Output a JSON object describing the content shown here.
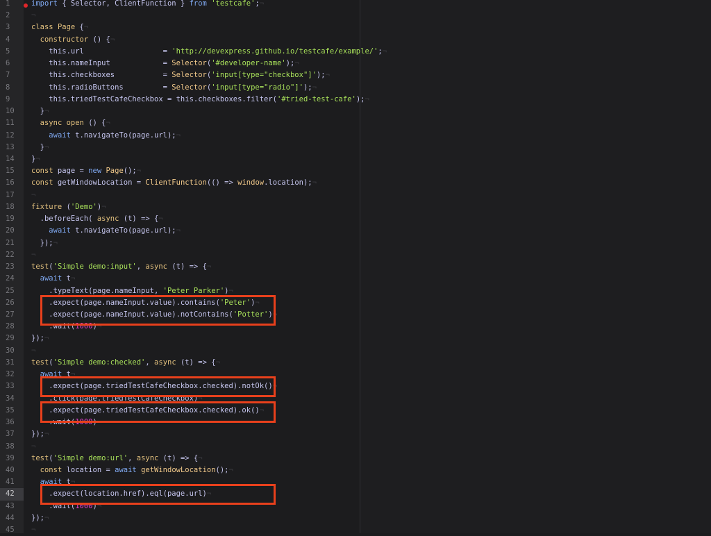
{
  "editor": {
    "current_line": 42,
    "breakpoint_line": 1,
    "highlight_color": "#e8401c",
    "lines": [
      [
        [
          "k",
          "import"
        ],
        [
          "p",
          " { Selector, ClientFunction } "
        ],
        [
          "k",
          "from"
        ],
        [
          "p",
          " "
        ],
        [
          "s",
          "'testcafe'"
        ],
        [
          "p",
          ";"
        ]
      ],
      [],
      [
        [
          "d",
          "class"
        ],
        [
          "p",
          " "
        ],
        [
          "d",
          "Page"
        ],
        [
          "p",
          " {"
        ]
      ],
      [
        [
          "p",
          "  "
        ],
        [
          "d",
          "constructor"
        ],
        [
          "p",
          " () {"
        ]
      ],
      [
        [
          "p",
          "    this.url                  = "
        ],
        [
          "s",
          "'http://devexpress.github.io/testcafe/example/'"
        ],
        [
          "p",
          ";"
        ]
      ],
      [
        [
          "p",
          "    this.nameInput            = "
        ],
        [
          "f",
          "Selector"
        ],
        [
          "p",
          "("
        ],
        [
          "s",
          "'#developer-name'"
        ],
        [
          "p",
          ");"
        ]
      ],
      [
        [
          "p",
          "    this.checkboxes           = "
        ],
        [
          "f",
          "Selector"
        ],
        [
          "p",
          "("
        ],
        [
          "s",
          "'input[type=\"checkbox\"]'"
        ],
        [
          "p",
          ");"
        ]
      ],
      [
        [
          "p",
          "    this.radioButtons         = "
        ],
        [
          "f",
          "Selector"
        ],
        [
          "p",
          "("
        ],
        [
          "s",
          "'input[type=\"radio\"]'"
        ],
        [
          "p",
          ");"
        ]
      ],
      [
        [
          "p",
          "    this.triedTestCafeCheckbox = this.checkboxes.filter("
        ],
        [
          "s",
          "'#tried-test-cafe'"
        ],
        [
          "p",
          ");"
        ]
      ],
      [
        [
          "p",
          "  }"
        ]
      ],
      [
        [
          "p",
          "  "
        ],
        [
          "d",
          "async"
        ],
        [
          "p",
          " "
        ],
        [
          "d",
          "open"
        ],
        [
          "p",
          " () {"
        ]
      ],
      [
        [
          "p",
          "    "
        ],
        [
          "k",
          "await"
        ],
        [
          "p",
          " t.navigateTo(page.url);"
        ]
      ],
      [
        [
          "p",
          "  }"
        ]
      ],
      [
        [
          "p",
          "}"
        ]
      ],
      [
        [
          "d",
          "const"
        ],
        [
          "p",
          " page = "
        ],
        [
          "k",
          "new"
        ],
        [
          "p",
          " "
        ],
        [
          "f",
          "Page"
        ],
        [
          "p",
          "();"
        ]
      ],
      [
        [
          "d",
          "const"
        ],
        [
          "p",
          " getWindowLocation = "
        ],
        [
          "f",
          "ClientFunction"
        ],
        [
          "p",
          "(() => "
        ],
        [
          "f",
          "window"
        ],
        [
          "p",
          ".location);"
        ]
      ],
      [],
      [
        [
          "d",
          "fixture"
        ],
        [
          "p",
          " ("
        ],
        [
          "s",
          "'Demo'"
        ],
        [
          "p",
          ")"
        ]
      ],
      [
        [
          "p",
          "  .beforeEach( "
        ],
        [
          "d",
          "async"
        ],
        [
          "p",
          " (t) => {"
        ]
      ],
      [
        [
          "p",
          "    "
        ],
        [
          "k",
          "await"
        ],
        [
          "p",
          " t.navigateTo(page.url);"
        ]
      ],
      [
        [
          "p",
          "  });"
        ]
      ],
      [],
      [
        [
          "d",
          "test"
        ],
        [
          "p",
          "("
        ],
        [
          "s",
          "'Simple demo:input'"
        ],
        [
          "p",
          ", "
        ],
        [
          "d",
          "async"
        ],
        [
          "p",
          " (t) => {"
        ]
      ],
      [
        [
          "p",
          "  "
        ],
        [
          "k",
          "await"
        ],
        [
          "p",
          " t"
        ]
      ],
      [
        [
          "p",
          "    .typeText(page.nameInput, "
        ],
        [
          "s",
          "'Peter Parker'"
        ],
        [
          "p",
          ")"
        ]
      ],
      [
        [
          "p",
          "    .expect(page.nameInput.value).contains("
        ],
        [
          "s",
          "'Peter'"
        ],
        [
          "p",
          ")"
        ]
      ],
      [
        [
          "p",
          "    .expect(page.nameInput.value).notContains("
        ],
        [
          "s",
          "'Potter'"
        ],
        [
          "p",
          ")"
        ]
      ],
      [
        [
          "p",
          "    .wait("
        ],
        [
          "n",
          "1000"
        ],
        [
          "p",
          ")"
        ]
      ],
      [
        [
          "p",
          "});"
        ]
      ],
      [],
      [
        [
          "d",
          "test"
        ],
        [
          "p",
          "("
        ],
        [
          "s",
          "'Simple demo:checked'"
        ],
        [
          "p",
          ", "
        ],
        [
          "d",
          "async"
        ],
        [
          "p",
          " (t) => {"
        ]
      ],
      [
        [
          "p",
          "  "
        ],
        [
          "k",
          "await"
        ],
        [
          "p",
          " t"
        ]
      ],
      [
        [
          "p",
          "    .expect(page.triedTestCafeCheckbox.checked).notOk()"
        ]
      ],
      [
        [
          "p",
          "    .click(page.triedTestCafeCheckbox)"
        ]
      ],
      [
        [
          "p",
          "    .expect(page.triedTestCafeCheckbox.checked).ok()"
        ]
      ],
      [
        [
          "p",
          "    .wait("
        ],
        [
          "n",
          "1000"
        ],
        [
          "p",
          ")"
        ]
      ],
      [
        [
          "p",
          "});"
        ]
      ],
      [],
      [
        [
          "d",
          "test"
        ],
        [
          "p",
          "("
        ],
        [
          "s",
          "'Simple demo:url'"
        ],
        [
          "p",
          ", "
        ],
        [
          "d",
          "async"
        ],
        [
          "p",
          " (t) => {"
        ]
      ],
      [
        [
          "p",
          "  "
        ],
        [
          "d",
          "const"
        ],
        [
          "p",
          " location = "
        ],
        [
          "k",
          "await"
        ],
        [
          "p",
          " "
        ],
        [
          "f",
          "getWindowLocation"
        ],
        [
          "p",
          "();"
        ]
      ],
      [
        [
          "p",
          "  "
        ],
        [
          "k",
          "await"
        ],
        [
          "p",
          " t"
        ]
      ],
      [
        [
          "p",
          "    .expect(location.href).eql(page.url)"
        ]
      ],
      [
        [
          "p",
          "    .wait("
        ],
        [
          "n",
          "1000"
        ],
        [
          "p",
          ")"
        ]
      ],
      [
        [
          "p",
          "});"
        ]
      ],
      []
    ]
  }
}
